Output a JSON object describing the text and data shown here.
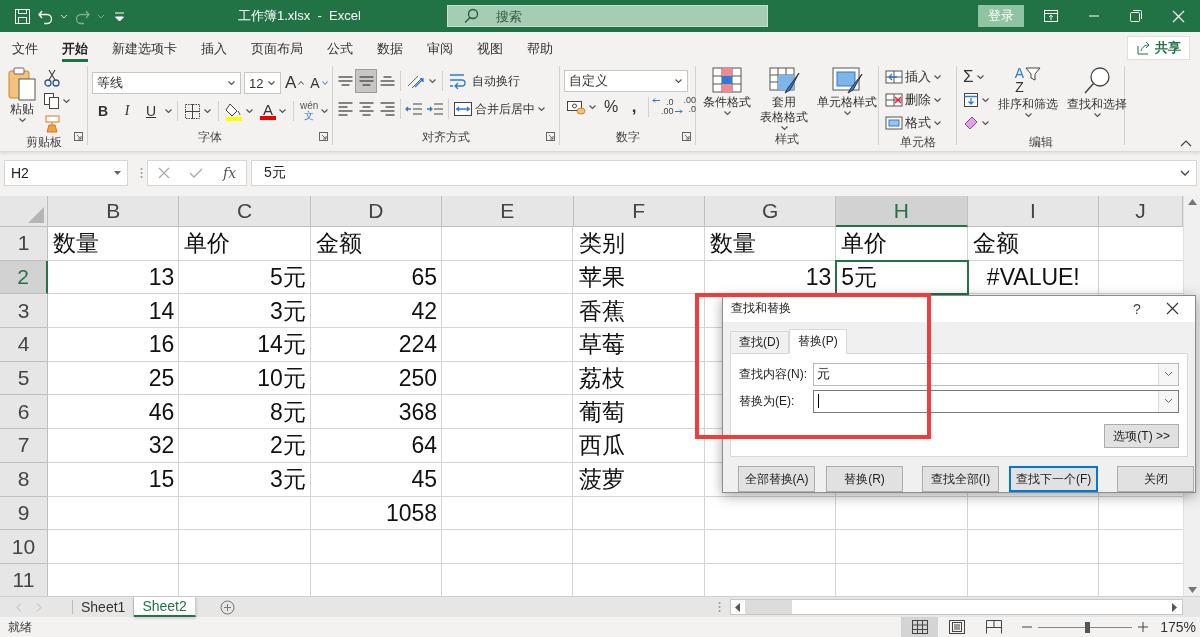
{
  "title_bar": {
    "quick_access": [
      {
        "kind": "save",
        "disabled": false
      },
      {
        "kind": "undo",
        "disabled": false
      },
      {
        "kind": "redo",
        "disabled": true
      },
      {
        "kind": "customize",
        "disabled": false
      }
    ],
    "title": "工作簿1.xlsx  -  Excel",
    "search": {
      "placeholder": "搜索"
    },
    "sign_in": "登录"
  },
  "ribbon_tabs": [
    {
      "label": "文件",
      "selected": false
    },
    {
      "label": "开始",
      "selected": true
    },
    {
      "label": "新建选项卡",
      "selected": false
    },
    {
      "label": "插入",
      "selected": false
    },
    {
      "label": "页面布局",
      "selected": false
    },
    {
      "label": "公式",
      "selected": false
    },
    {
      "label": "数据",
      "selected": false
    },
    {
      "label": "审阅",
      "selected": false
    },
    {
      "label": "视图",
      "selected": false
    },
    {
      "label": "帮助",
      "selected": false
    }
  ],
  "share": "共享",
  "ribbon": {
    "clipboard": {
      "label": "剪贴板",
      "paste": "粘贴"
    },
    "font": {
      "label": "字体",
      "font_name": "等线",
      "font_size": "12",
      "grow": "A",
      "shrink": "A",
      "bold": "B",
      "italic": "I",
      "underline": "U",
      "font_color": "A",
      "phonetic": [
        "wén",
        "文"
      ]
    },
    "alignment": {
      "label": "对齐方式",
      "buttons": [
        {
          "kind": "top",
          "selected": false
        },
        {
          "kind": "middle",
          "selected": true
        },
        {
          "kind": "bottom",
          "selected": false
        },
        {
          "kind": "left",
          "selected": false
        },
        {
          "kind": "center",
          "selected": false
        },
        {
          "kind": "right",
          "selected": false
        }
      ],
      "wrap_text": "自动换行",
      "merge_center": "合并后居中"
    },
    "number": {
      "label": "数字",
      "format": "自定义",
      "percent": "%",
      "comma": ",",
      "increase_decimal": [
        ".0",
        ".00"
      ],
      "decrease_decimal": [
        ".00",
        ".0"
      ]
    },
    "styles": {
      "label": "样式",
      "buttons": [
        {
          "kind": "conditional",
          "lines": [
            "条件格式"
          ]
        },
        {
          "kind": "table",
          "lines": [
            "套用",
            "表格格式"
          ]
        },
        {
          "kind": "cell-style",
          "lines": [
            "单元格样式"
          ]
        }
      ]
    },
    "cells": {
      "label": "单元格",
      "buttons": [
        {
          "kind": "insert",
          "label": "插入"
        },
        {
          "kind": "delete",
          "label": "删除"
        },
        {
          "kind": "format",
          "label": "格式"
        }
      ]
    },
    "editing": {
      "label": "编辑",
      "sum": "Σ",
      "sort_letters": [
        "A",
        "Z"
      ],
      "sort": "排序和筛选",
      "find": "查找和选择"
    }
  },
  "formula_bar": {
    "name_box": "H2",
    "fx": "fx",
    "value": "5元"
  },
  "sheet": {
    "columns": [
      {
        "label": "B",
        "selected": false
      },
      {
        "label": "C",
        "selected": false
      },
      {
        "label": "D",
        "selected": false
      },
      {
        "label": "E",
        "selected": false
      },
      {
        "label": "F",
        "selected": false
      },
      {
        "label": "G",
        "selected": false
      },
      {
        "label": "H",
        "selected": true
      },
      {
        "label": "I",
        "selected": false
      },
      {
        "label": "J",
        "selected": false
      }
    ],
    "rows": [
      {
        "label": "1",
        "selected": false,
        "cells": [
          {
            "kind": "text",
            "text": "数量"
          },
          {
            "kind": "text",
            "text": "单价"
          },
          {
            "kind": "text",
            "text": "金额"
          },
          {
            "kind": "empty"
          },
          {
            "kind": "text",
            "text": "类别"
          },
          {
            "kind": "text",
            "text": "数量"
          },
          {
            "kind": "text",
            "text": "单价"
          },
          {
            "kind": "text",
            "text": "金额"
          }
        ]
      },
      {
        "label": "2",
        "selected": true,
        "cells": [
          {
            "kind": "number",
            "text": "13"
          },
          {
            "kind": "number",
            "text": "5元"
          },
          {
            "kind": "number",
            "text": "65"
          },
          {
            "kind": "empty"
          },
          {
            "kind": "text",
            "text": "苹果"
          },
          {
            "kind": "number",
            "text": "13"
          },
          {
            "kind": "text",
            "text": "5元"
          },
          {
            "kind": "error",
            "text": "#VALUE!"
          }
        ]
      },
      {
        "label": "3",
        "selected": false,
        "cells": [
          {
            "kind": "number",
            "text": "14"
          },
          {
            "kind": "number",
            "text": "3元"
          },
          {
            "kind": "number",
            "text": "42"
          },
          {
            "kind": "empty"
          },
          {
            "kind": "text",
            "text": "香蕉"
          }
        ]
      },
      {
        "label": "4",
        "selected": false,
        "cells": [
          {
            "kind": "number",
            "text": "16"
          },
          {
            "kind": "number",
            "text": "14元"
          },
          {
            "kind": "number",
            "text": "224"
          },
          {
            "kind": "empty"
          },
          {
            "kind": "text",
            "text": "草莓"
          }
        ]
      },
      {
        "label": "5",
        "selected": false,
        "cells": [
          {
            "kind": "number",
            "text": "25"
          },
          {
            "kind": "number",
            "text": "10元"
          },
          {
            "kind": "number",
            "text": "250"
          },
          {
            "kind": "empty"
          },
          {
            "kind": "text",
            "text": "荔枝"
          }
        ]
      },
      {
        "label": "6",
        "selected": false,
        "cells": [
          {
            "kind": "number",
            "text": "46"
          },
          {
            "kind": "number",
            "text": "8元"
          },
          {
            "kind": "number",
            "text": "368"
          },
          {
            "kind": "empty"
          },
          {
            "kind": "text",
            "text": "葡萄"
          }
        ]
      },
      {
        "label": "7",
        "selected": false,
        "cells": [
          {
            "kind": "number",
            "text": "32"
          },
          {
            "kind": "number",
            "text": "2元"
          },
          {
            "kind": "number",
            "text": "64"
          },
          {
            "kind": "empty"
          },
          {
            "kind": "text",
            "text": "西瓜"
          }
        ]
      },
      {
        "label": "8",
        "selected": false,
        "cells": [
          {
            "kind": "number",
            "text": "15"
          },
          {
            "kind": "number",
            "text": "3元"
          },
          {
            "kind": "number",
            "text": "45"
          },
          {
            "kind": "empty"
          },
          {
            "kind": "text",
            "text": "菠萝"
          }
        ]
      },
      {
        "label": "9",
        "selected": false,
        "cells": [
          {
            "kind": "empty"
          },
          {
            "kind": "empty"
          },
          {
            "kind": "number",
            "text": "1058"
          }
        ]
      },
      {
        "label": "10",
        "selected": false
      },
      {
        "label": "11",
        "selected": false
      }
    ]
  },
  "find_replace": {
    "title": "查找和替换",
    "help": "?",
    "tabs": [
      {
        "label": "查找(D)",
        "selected": false
      },
      {
        "label": "替换(P)",
        "selected": true
      }
    ],
    "fields": [
      {
        "label": "查找内容(N):",
        "value": "元",
        "focused": false
      },
      {
        "label": "替换为(E):",
        "focused": true
      }
    ],
    "options": "选项(T) >>",
    "buttons": [
      {
        "label": "全部替换(A)",
        "default": false
      },
      {
        "label": "替换(R)",
        "default": false
      },
      {
        "label": "查找全部(I)",
        "default": false
      },
      {
        "label": "查找下一个(F)",
        "default": true
      },
      {
        "label": "关闭",
        "default": false
      }
    ]
  },
  "highlight": {
    "color": "#f03c3c"
  },
  "sheet_tabs": [
    {
      "label": "Sheet1",
      "selected": false
    },
    {
      "label": "Sheet2",
      "selected": true
    }
  ],
  "status_bar": {
    "status": "就绪",
    "views": [
      {
        "kind": "normal",
        "selected": true
      },
      {
        "kind": "page-layout",
        "selected": false
      },
      {
        "kind": "page-break",
        "selected": false
      }
    ],
    "zoom": {
      "level": 0.52,
      "reading": "175%"
    }
  }
}
